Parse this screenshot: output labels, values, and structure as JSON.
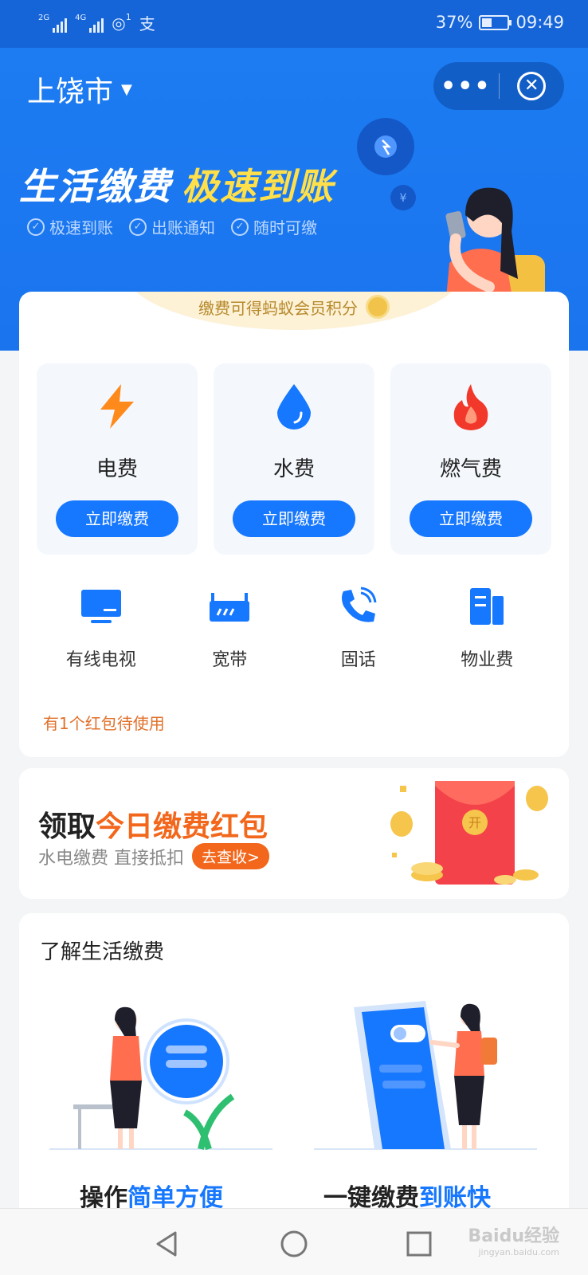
{
  "status_bar": {
    "network1": "2G",
    "network2": "4G",
    "hotspot_count": "1",
    "app_badge": "支",
    "battery_percent": "37%",
    "battery_level": 0.37,
    "time": "09:49"
  },
  "header": {
    "city": "上饶市",
    "more_label": "•••",
    "close_label": "✕"
  },
  "hero": {
    "slogan_white": "生活缴费",
    "slogan_yellow": "极速到账",
    "features": [
      "极速到账",
      "出账通知",
      "随时可缴"
    ]
  },
  "main": {
    "points_note": "缴费可得蚂蚁会员积分",
    "tiles": [
      {
        "name": "电费",
        "button": "立即缴费",
        "icon": "lightning-icon"
      },
      {
        "name": "水费",
        "button": "立即缴费",
        "icon": "water-drop-icon"
      },
      {
        "name": "燃气费",
        "button": "立即缴费",
        "icon": "flame-icon"
      }
    ],
    "services": [
      {
        "name": "有线电视",
        "icon": "tv-icon"
      },
      {
        "name": "宽带",
        "icon": "router-icon"
      },
      {
        "name": "固话",
        "icon": "phone-icon"
      },
      {
        "name": "物业费",
        "icon": "building-icon"
      }
    ],
    "coupon_tip": "有1个红包待使用"
  },
  "red_packet": {
    "title_black": "领取",
    "title_orange": "今日缴费红包",
    "subtitle": "水电缴费 直接抵扣",
    "check_button": "去查收>",
    "packet_char": "开"
  },
  "learn": {
    "title": "了解生活缴费",
    "card1_black": "操作",
    "card1_blue": "简单方便",
    "card2_black": "一键缴费",
    "card2_blue": "到账快"
  },
  "watermark": {
    "text": "Baidu经验",
    "url": "jingyan.baidu.com"
  },
  "colors": {
    "brand_blue": "#1677ff",
    "status_blue": "#1565d8",
    "orange": "#f2671b",
    "yellow": "#ffe04a"
  }
}
